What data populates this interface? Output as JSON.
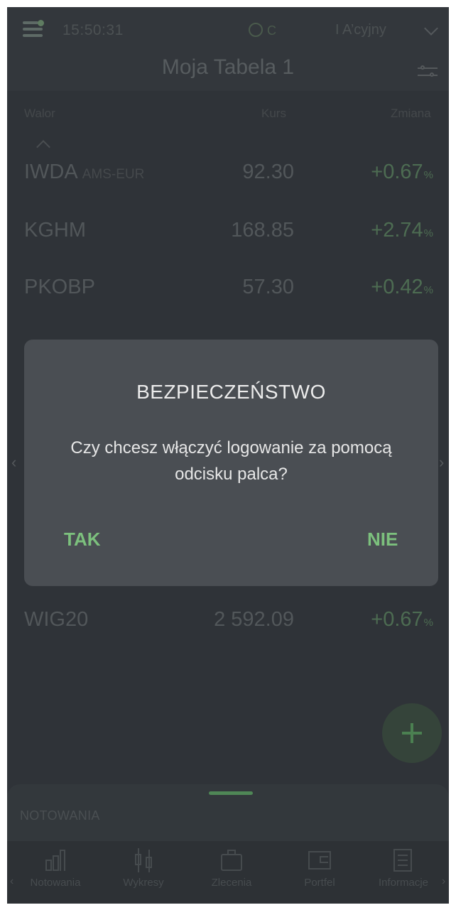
{
  "status": {
    "time": "15:50:31",
    "indicator": "C",
    "account": "I A’cyjny"
  },
  "header": {
    "title": "Moja Tabela 1"
  },
  "table": {
    "columns": {
      "symbol": "Walor",
      "price": "Kurs",
      "change": "Zmiana"
    },
    "rows": [
      {
        "symbol": "IWDA",
        "exchange": "AMS-EUR",
        "price": "92.30",
        "change": "+0.67",
        "pct": "%"
      },
      {
        "symbol": "KGHM",
        "exchange": "",
        "price": "168.85",
        "change": "+2.74",
        "pct": "%"
      },
      {
        "symbol": "PKOBP",
        "exchange": "",
        "price": "57.30",
        "change": "+0.42",
        "pct": "%"
      },
      {
        "symbol": "WIG20",
        "exchange": "",
        "price": "2 592.09",
        "change": "+0.67",
        "pct": "%"
      }
    ]
  },
  "dialog": {
    "title": "BEZPIECZEŃSTWO",
    "message": "Czy chcesz włączyć logowanie za pomocą odcisku palca?",
    "confirm": "TAK",
    "cancel": "NIE"
  },
  "panel": {
    "label": "NOTOWANIA"
  },
  "nav": {
    "items": [
      {
        "label": "Notowania",
        "icon": "chart-icon"
      },
      {
        "label": "Wykresy",
        "icon": "candlestick-icon"
      },
      {
        "label": "Zlecenia",
        "icon": "briefcase-icon"
      },
      {
        "label": "Portfel",
        "icon": "wallet-icon"
      },
      {
        "label": "Informacje",
        "icon": "news-icon"
      }
    ]
  },
  "colors": {
    "accent": "#7cc07d",
    "dialog_bg": "#4a4e53",
    "background": "#2f3338"
  }
}
